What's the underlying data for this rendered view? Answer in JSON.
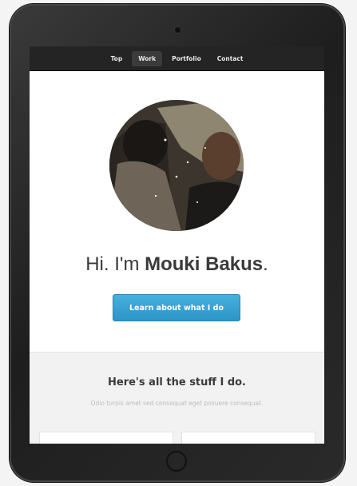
{
  "nav": {
    "items": [
      {
        "label": "Top"
      },
      {
        "label": "Work"
      },
      {
        "label": "Portfolio"
      },
      {
        "label": "Contact"
      }
    ]
  },
  "hero": {
    "greeting": "Hi. I'm ",
    "name": "Mouki Bakus",
    "punctuation": ".",
    "cta_label": "Learn about what I do"
  },
  "work_section": {
    "title": "Here's all the stuff I do.",
    "subtitle": "Odio turpis amet sed consequat eget posuere consequat."
  },
  "colors": {
    "nav_bg": "#242424",
    "accent": "#3aa3d2",
    "text": "#3a3a3a"
  }
}
